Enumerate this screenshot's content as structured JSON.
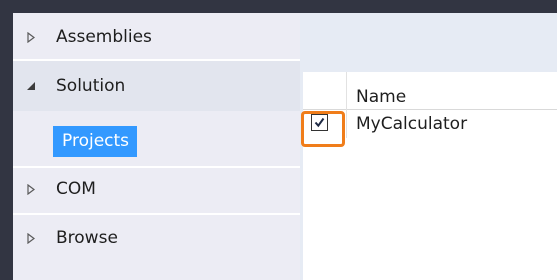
{
  "nav": {
    "items": [
      {
        "label": "Assemblies",
        "state": "collapsed"
      },
      {
        "label": "Solution",
        "state": "expanded"
      },
      {
        "label": "COM",
        "state": "collapsed"
      },
      {
        "label": "Browse",
        "state": "collapsed"
      }
    ],
    "sub_items": [
      {
        "label": "Projects",
        "selected": true
      }
    ]
  },
  "grid": {
    "columns": [
      "",
      "Name"
    ],
    "rows": [
      {
        "checked": true,
        "name": "MyCalculator"
      }
    ]
  },
  "colors": {
    "selection": "#3399ff",
    "highlight_ring": "#f07d1a",
    "nav_background": "#ececf4",
    "dark_border": "#323542"
  },
  "icons": {
    "collapsed": "triangle-right-outline-icon",
    "expanded": "triangle-down-filled-icon",
    "checked": "checkmark-icon"
  }
}
